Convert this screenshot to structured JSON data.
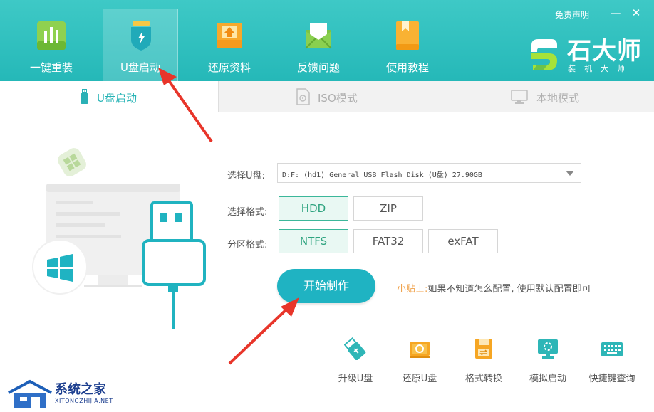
{
  "nav": {
    "items": [
      {
        "label": "一键重装",
        "icon": "bar-chart-icon"
      },
      {
        "label": "U盘启动",
        "icon": "usb-shield-icon"
      },
      {
        "label": "还原资料",
        "icon": "restore-upload-icon"
      },
      {
        "label": "反馈问题",
        "icon": "mail-icon"
      },
      {
        "label": "使用教程",
        "icon": "book-icon"
      }
    ],
    "active_index": 1
  },
  "header": {
    "disclaimer": "免责声明",
    "minimize": "—",
    "close": "✕"
  },
  "brand": {
    "name": "石大师",
    "sub": "装机大师"
  },
  "tabs": [
    {
      "label": "U盘启动",
      "icon": "usb-drive-icon"
    },
    {
      "label": "ISO模式",
      "icon": "iso-file-icon"
    },
    {
      "label": "本地模式",
      "icon": "monitor-icon"
    }
  ],
  "form": {
    "usb_label": "选择U盘:",
    "usb_value": "D:F: (hd1) General USB Flash Disk  (U盘) 27.90GB",
    "format_label": "选择格式:",
    "format_options": [
      "HDD",
      "ZIP"
    ],
    "format_selected": "HDD",
    "partition_label": "分区格式:",
    "partition_options": [
      "NTFS",
      "FAT32",
      "exFAT"
    ],
    "partition_selected": "NTFS"
  },
  "start_button": "开始制作",
  "tip": {
    "title": "小贴士:",
    "text": "如果不知道怎么配置, 使用默认配置即可"
  },
  "tools": [
    {
      "label": "升级U盘",
      "icon": "usb-upgrade-icon"
    },
    {
      "label": "还原U盘",
      "icon": "usb-restore-icon"
    },
    {
      "label": "格式转换",
      "icon": "format-convert-icon"
    },
    {
      "label": "模拟启动",
      "icon": "simulate-boot-icon"
    },
    {
      "label": "快捷键查询",
      "icon": "keyboard-icon"
    }
  ],
  "watermark": {
    "text": "系统之家",
    "sub": "XITONGZHIJIA.NET"
  },
  "colors": {
    "header_teal": "#2dbdbd",
    "accent": "#1fb3c2",
    "selected_green": "#2ea37f",
    "tip_orange": "#f0a24b",
    "arrow_red": "#e8352a"
  }
}
